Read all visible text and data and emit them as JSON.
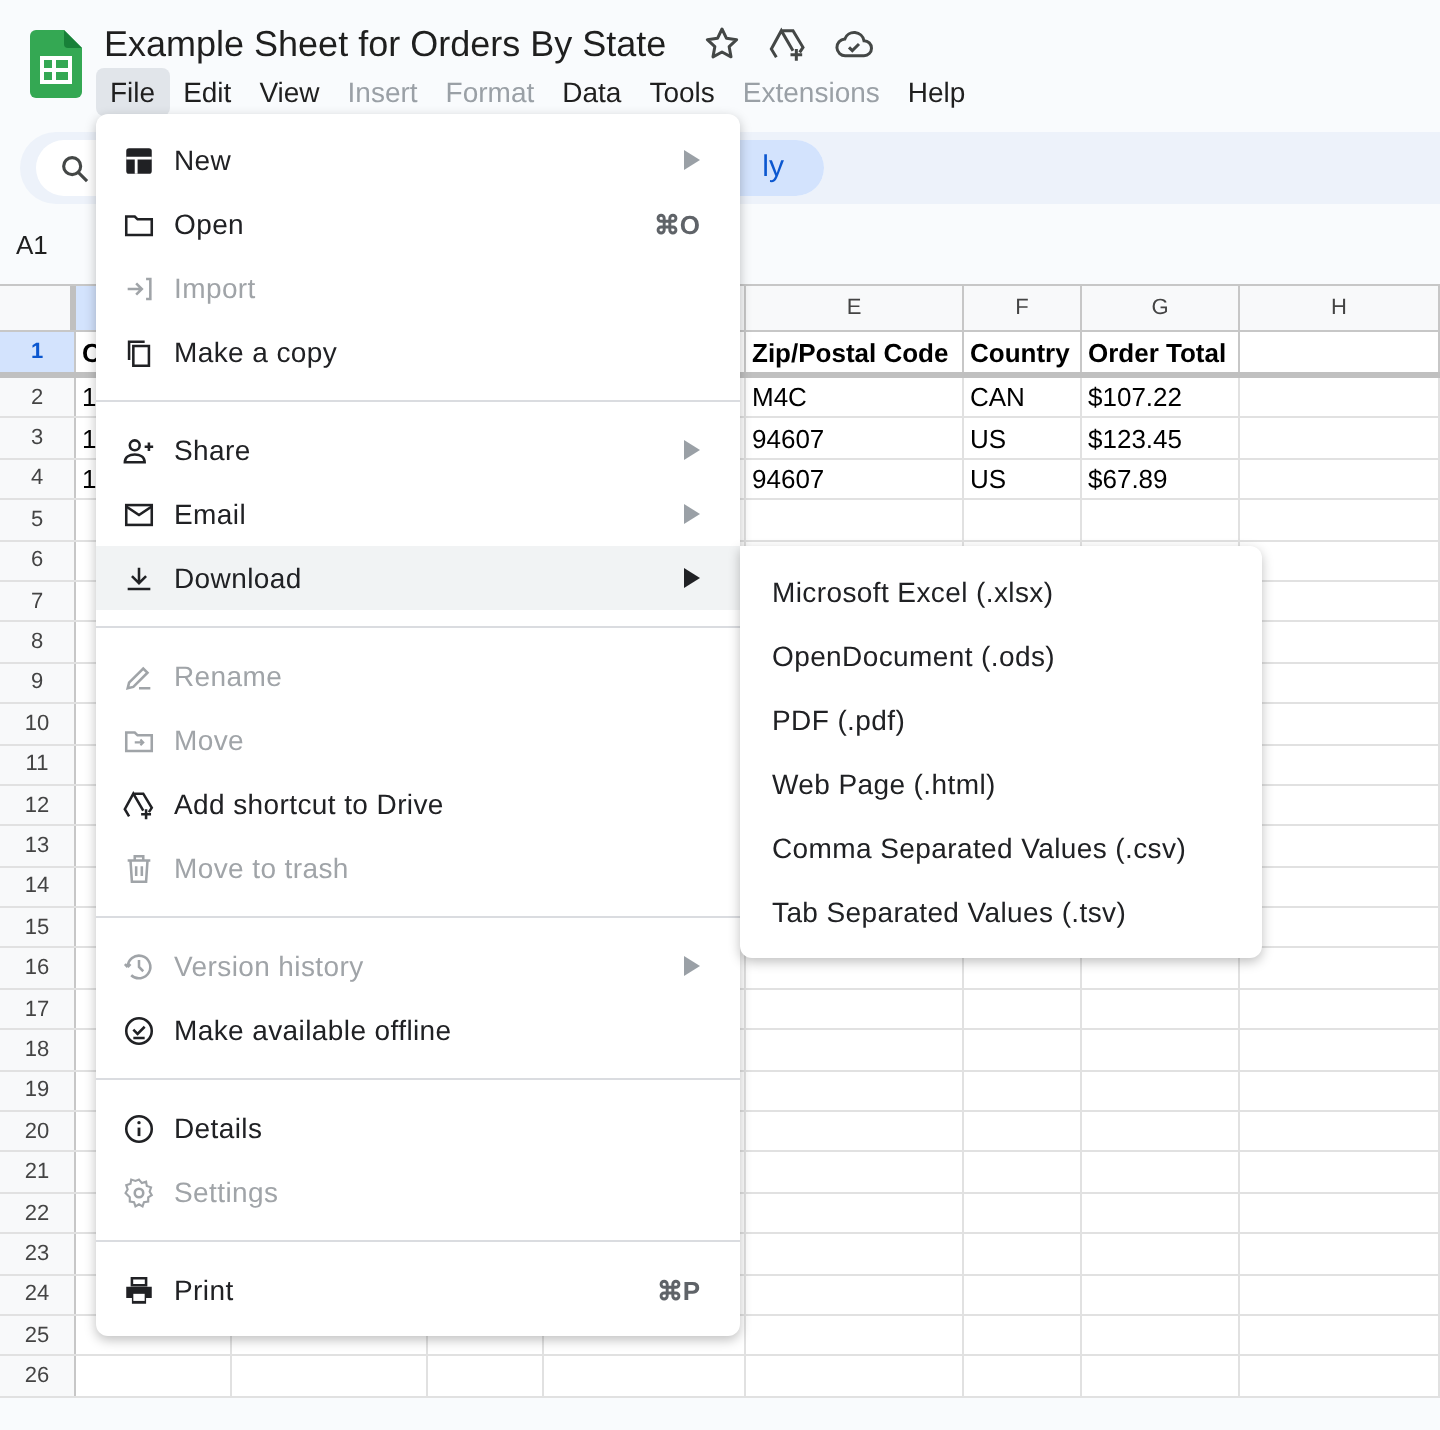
{
  "title": "Example Sheet for Orders By State",
  "menubar": [
    {
      "label": "File",
      "selected": true,
      "disabled": false
    },
    {
      "label": "Edit",
      "selected": false,
      "disabled": false
    },
    {
      "label": "View",
      "selected": false,
      "disabled": false
    },
    {
      "label": "Insert",
      "selected": false,
      "disabled": true
    },
    {
      "label": "Format",
      "selected": false,
      "disabled": true
    },
    {
      "label": "Data",
      "selected": false,
      "disabled": false
    },
    {
      "label": "Tools",
      "selected": false,
      "disabled": false
    },
    {
      "label": "Extensions",
      "selected": false,
      "disabled": true
    },
    {
      "label": "Help",
      "selected": false,
      "disabled": false
    }
  ],
  "toolbar": {
    "pill_text": "ly"
  },
  "name_box": "A1",
  "columns": [
    "E",
    "F",
    "G",
    "H"
  ],
  "rows": [
    {
      "number": "1",
      "selected": true,
      "bold": true,
      "first_cell": "C",
      "cells": [
        "Zip/Postal Code",
        "Country",
        "Order Total"
      ]
    },
    {
      "number": "2",
      "selected": false,
      "bold": false,
      "first_cell": "1",
      "cells": [
        "M4C",
        "CAN",
        "$107.22"
      ]
    },
    {
      "number": "3",
      "selected": false,
      "bold": false,
      "first_cell": "1",
      "cells": [
        "94607",
        "US",
        "$123.45"
      ]
    },
    {
      "number": "4",
      "selected": false,
      "bold": false,
      "first_cell": "1",
      "cells": [
        "94607",
        "US",
        "$67.89"
      ]
    },
    {
      "number": "5"
    },
    {
      "number": "6"
    },
    {
      "number": "7"
    },
    {
      "number": "8"
    },
    {
      "number": "9"
    },
    {
      "number": "10"
    },
    {
      "number": "11"
    },
    {
      "number": "12"
    },
    {
      "number": "13"
    },
    {
      "number": "14"
    },
    {
      "number": "15"
    },
    {
      "number": "16"
    },
    {
      "number": "17"
    },
    {
      "number": "18"
    },
    {
      "number": "19"
    },
    {
      "number": "20"
    },
    {
      "number": "21"
    },
    {
      "number": "22"
    },
    {
      "number": "23"
    },
    {
      "number": "24"
    },
    {
      "number": "25"
    },
    {
      "number": "26"
    }
  ],
  "file_menu": {
    "sections": [
      [
        {
          "label": "New",
          "disabled": false,
          "selected": false,
          "submenu": true
        },
        {
          "label": "Open",
          "shortcut": "⌘O",
          "disabled": false,
          "selected": false,
          "submenu": false
        },
        {
          "label": "Import",
          "disabled": true,
          "selected": false,
          "submenu": false
        },
        {
          "label": "Make a copy",
          "disabled": false,
          "selected": false,
          "submenu": false
        }
      ],
      [
        {
          "label": "Share",
          "disabled": false,
          "selected": false,
          "submenu": true
        },
        {
          "label": "Email",
          "disabled": false,
          "selected": false,
          "submenu": true
        },
        {
          "label": "Download",
          "disabled": false,
          "selected": true,
          "submenu": true
        }
      ],
      [
        {
          "label": "Rename",
          "disabled": true,
          "selected": false,
          "submenu": false
        },
        {
          "label": "Move",
          "disabled": true,
          "selected": false,
          "submenu": false
        },
        {
          "label": "Add shortcut to Drive",
          "disabled": false,
          "selected": false,
          "submenu": false
        },
        {
          "label": "Move to trash",
          "disabled": true,
          "selected": false,
          "submenu": false
        }
      ],
      [
        {
          "label": "Version history",
          "disabled": true,
          "selected": false,
          "submenu": true
        },
        {
          "label": "Make available offline",
          "disabled": false,
          "selected": false,
          "submenu": false
        }
      ],
      [
        {
          "label": "Details",
          "disabled": false,
          "selected": false,
          "submenu": false
        },
        {
          "label": "Settings",
          "disabled": true,
          "selected": false,
          "submenu": false
        }
      ],
      [
        {
          "label": "Print",
          "shortcut": "⌘P",
          "disabled": false,
          "selected": false,
          "submenu": false
        }
      ]
    ]
  },
  "download_submenu": [
    "Microsoft Excel (.xlsx)",
    "OpenDocument (.ods)",
    "PDF (.pdf)",
    "Web Page (.html)",
    "Comma Separated Values (.csv)",
    "Tab Separated Values (.tsv)"
  ]
}
